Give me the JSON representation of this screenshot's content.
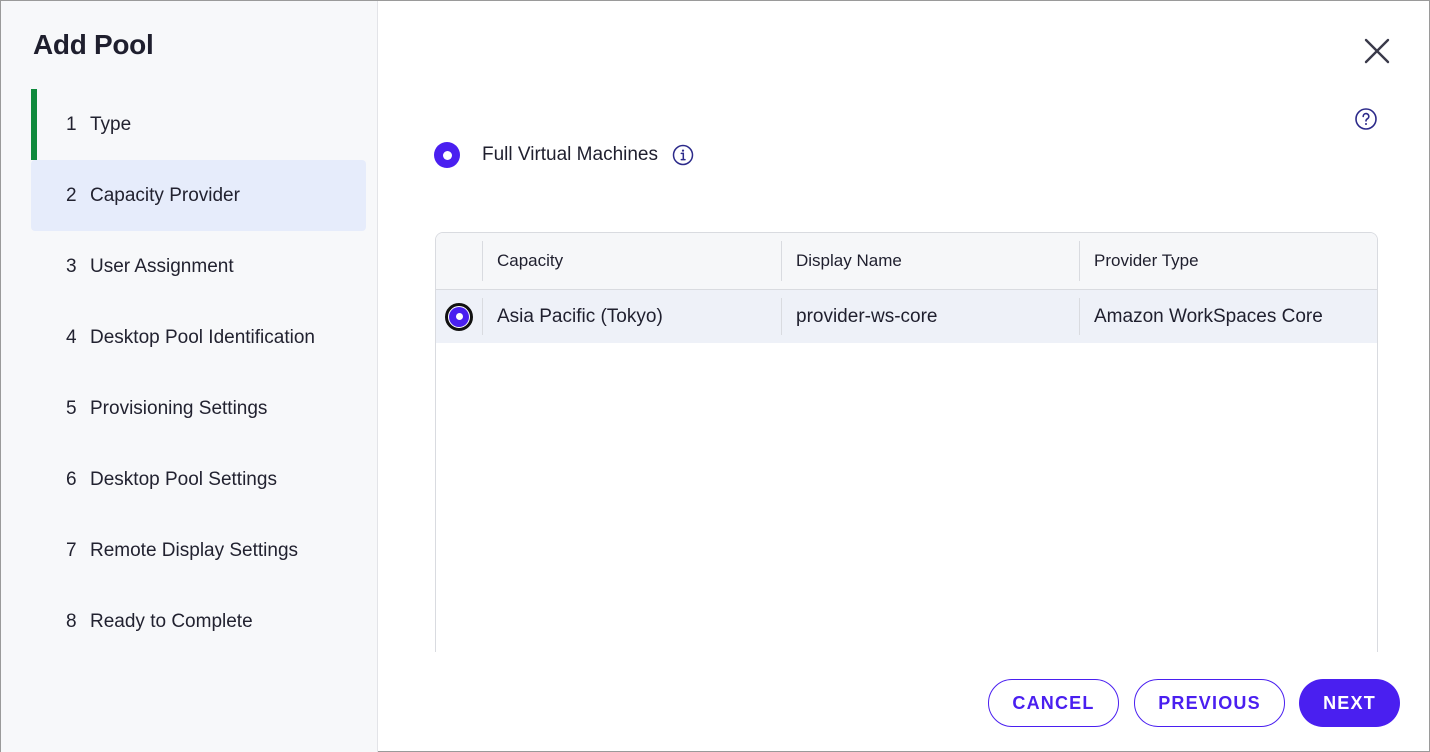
{
  "dialog": {
    "title": "Add Pool"
  },
  "steps": [
    {
      "num": "1",
      "label": "Type"
    },
    {
      "num": "2",
      "label": "Capacity Provider"
    },
    {
      "num": "3",
      "label": "User Assignment"
    },
    {
      "num": "4",
      "label": "Desktop Pool Identification"
    },
    {
      "num": "5",
      "label": "Provisioning Settings"
    },
    {
      "num": "6",
      "label": "Desktop Pool Settings"
    },
    {
      "num": "7",
      "label": "Remote Display Settings"
    },
    {
      "num": "8",
      "label": "Ready to Complete"
    }
  ],
  "icons": {
    "close": "close-icon",
    "help": "help-circle-icon",
    "info": "info-icon"
  },
  "vm_type": {
    "label": "Full Virtual Machines",
    "selected": true
  },
  "table": {
    "headers": {
      "capacity": "Capacity",
      "display_name": "Display Name",
      "provider_type": "Provider Type"
    },
    "rows": [
      {
        "capacity": "Asia Pacific (Tokyo)",
        "display_name": "provider-ws-core",
        "provider_type": "Amazon WorkSpaces Core",
        "selected": true
      }
    ]
  },
  "buttons": {
    "cancel": "CANCEL",
    "previous": "PREVIOUS",
    "next": "NEXT"
  },
  "colors": {
    "accent": "#4a1ff0",
    "active_step_marker": "#0f8a3c",
    "current_step_bg": "#e6ecfb"
  }
}
